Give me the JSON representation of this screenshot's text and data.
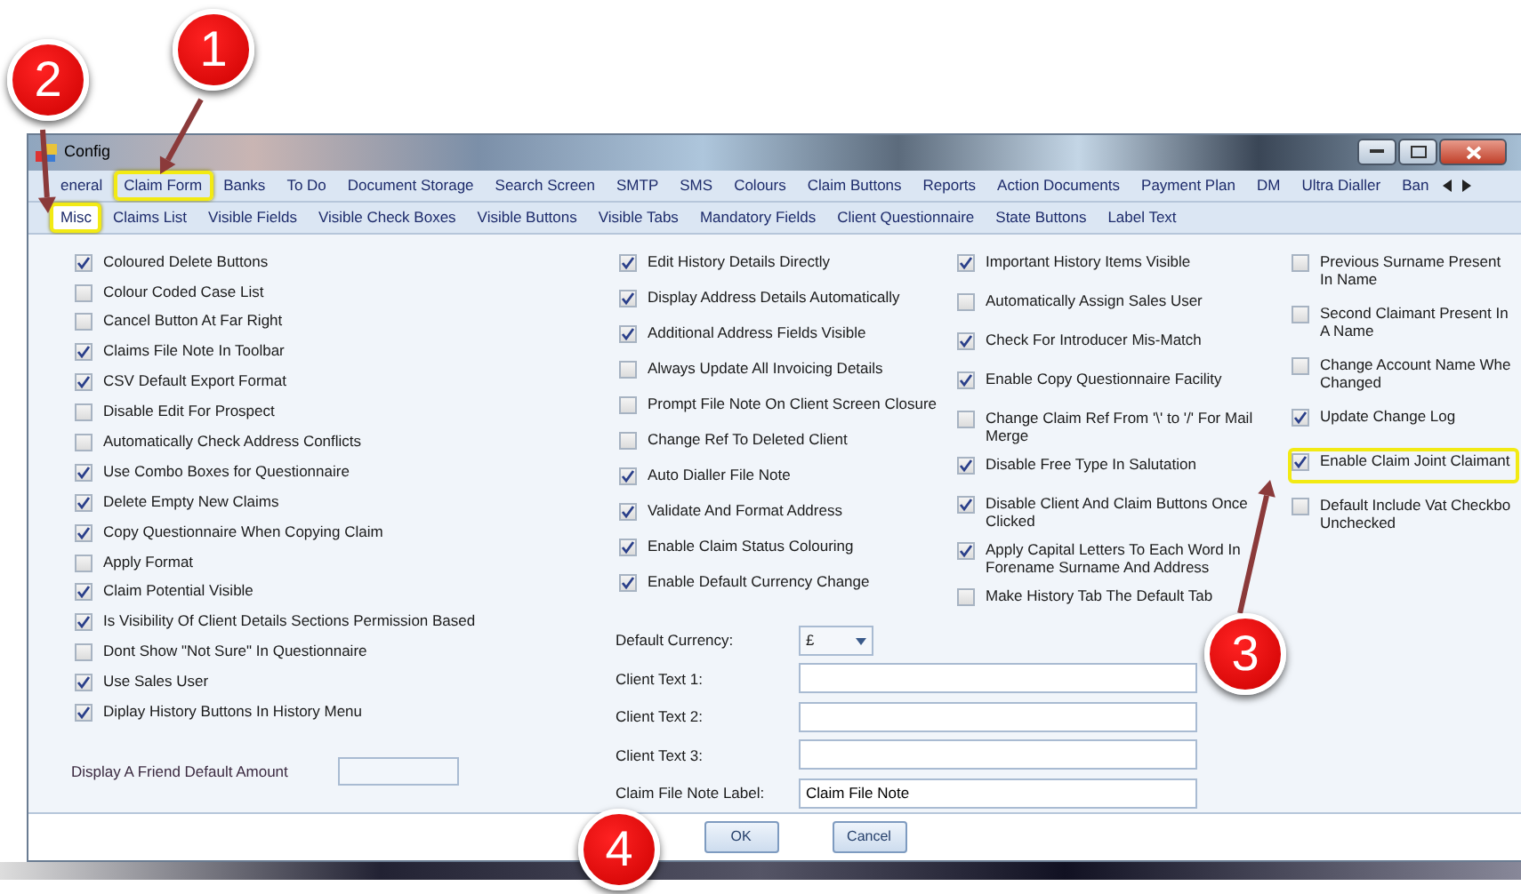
{
  "window": {
    "title": "Config"
  },
  "tabs_row_1": [
    {
      "label": "eneral",
      "selected": false,
      "highlighted": false
    },
    {
      "label": "Claim Form",
      "selected": false,
      "highlighted": true
    },
    {
      "label": "Banks",
      "selected": false,
      "highlighted": false
    },
    {
      "label": "To Do",
      "selected": false,
      "highlighted": false
    },
    {
      "label": "Document Storage",
      "selected": false,
      "highlighted": false
    },
    {
      "label": "Search Screen",
      "selected": false,
      "highlighted": false
    },
    {
      "label": "SMTP",
      "selected": false,
      "highlighted": false
    },
    {
      "label": "SMS",
      "selected": false,
      "highlighted": false
    },
    {
      "label": "Colours",
      "selected": false,
      "highlighted": false
    },
    {
      "label": "Claim Buttons",
      "selected": false,
      "highlighted": false
    },
    {
      "label": "Reports",
      "selected": false,
      "highlighted": false
    },
    {
      "label": "Action Documents",
      "selected": false,
      "highlighted": false
    },
    {
      "label": "Payment Plan",
      "selected": false,
      "highlighted": false
    },
    {
      "label": "DM",
      "selected": false,
      "highlighted": false
    },
    {
      "label": "Ultra Dialler",
      "selected": false,
      "highlighted": false
    },
    {
      "label": "Ban",
      "selected": false,
      "highlighted": false
    }
  ],
  "tabs_row_2": [
    {
      "label": "Misc",
      "selected": true,
      "highlighted": true
    },
    {
      "label": "Claims List",
      "selected": false,
      "highlighted": false
    },
    {
      "label": "Visible Fields",
      "selected": false,
      "highlighted": false
    },
    {
      "label": "Visible Check Boxes",
      "selected": false,
      "highlighted": false
    },
    {
      "label": "Visible Buttons",
      "selected": false,
      "highlighted": false
    },
    {
      "label": "Visible Tabs",
      "selected": false,
      "highlighted": false
    },
    {
      "label": "Mandatory Fields",
      "selected": false,
      "highlighted": false
    },
    {
      "label": "Client Questionnaire",
      "selected": false,
      "highlighted": false
    },
    {
      "label": "State Buttons",
      "selected": false,
      "highlighted": false
    },
    {
      "label": "Label Text",
      "selected": false,
      "highlighted": false
    }
  ],
  "column_1": [
    {
      "label": "Coloured Delete Buttons",
      "checked": true
    },
    {
      "label": "Colour Coded Case List",
      "checked": false
    },
    {
      "label": "Cancel Button At Far Right",
      "checked": false
    },
    {
      "label": "Claims File Note In Toolbar",
      "checked": true
    },
    {
      "label": "CSV Default Export Format",
      "checked": true
    },
    {
      "label": "Disable Edit For Prospect",
      "checked": false
    },
    {
      "label": "Automatically Check Address Conflicts",
      "checked": false
    },
    {
      "label": "Use Combo Boxes for Questionnaire",
      "checked": true
    },
    {
      "label": "Delete Empty New Claims",
      "checked": true
    },
    {
      "label": "Copy Questionnaire When Copying Claim",
      "checked": true
    },
    {
      "label": "Apply Format",
      "checked": false
    },
    {
      "label": "Claim Potential Visible",
      "checked": true
    },
    {
      "label": "Is Visibility Of Client Details Sections Permission Based",
      "checked": true
    },
    {
      "label": "Dont Show \"Not Sure\" In Questionnaire",
      "checked": false
    },
    {
      "label": "Use Sales User",
      "checked": true
    },
    {
      "label": "Diplay History Buttons In History Menu",
      "checked": true
    }
  ],
  "friend_amount": {
    "label": "Display A Friend Default Amount"
  },
  "column_2": [
    {
      "label": "Edit History Details Directly",
      "checked": true
    },
    {
      "label": "Display Address Details Automatically",
      "checked": true
    },
    {
      "label": "Additional Address Fields Visible",
      "checked": true
    },
    {
      "label": "Always Update All Invoicing Details",
      "checked": false
    },
    {
      "label": "Prompt File Note On Client Screen Closure",
      "checked": false
    },
    {
      "label": "Change Ref To Deleted Client",
      "checked": false
    },
    {
      "label": "Auto Dialler File Note",
      "checked": true
    },
    {
      "label": "Validate And Format Address",
      "checked": true
    },
    {
      "label": "Enable Claim Status Colouring",
      "checked": true
    },
    {
      "label": "Enable Default Currency Change",
      "checked": true
    }
  ],
  "default_currency": {
    "label": "Default Currency:",
    "value": "£"
  },
  "text_fields": [
    {
      "label": "Client Text 1:"
    },
    {
      "label": "Client Text 2:"
    },
    {
      "label": "Client Text 3:"
    },
    {
      "label": "Claim File Note Label:",
      "value": "Claim File Note"
    }
  ],
  "column_3": [
    {
      "label": "Important History Items Visible",
      "checked": true
    },
    {
      "label": "Automatically Assign Sales User",
      "checked": false
    },
    {
      "label": "Check For Introducer Mis-Match",
      "checked": true
    },
    {
      "label": "Enable Copy Questionnaire Facility",
      "checked": true
    },
    {
      "label": "Change Claim Ref  From '\\' to '/' For Mail Merge",
      "checked": false
    },
    {
      "label": "Disable Free Type In Salutation",
      "checked": true
    },
    {
      "label": "Disable Client And Claim Buttons Once Clicked",
      "checked": true
    },
    {
      "label": "Apply Capital Letters To Each Word In Forename Surname And Address",
      "checked": true
    },
    {
      "label": "Make History Tab The Default Tab",
      "checked": false
    }
  ],
  "column_4": [
    {
      "label": "Previous Surname Present In Name",
      "checked": false,
      "highlighted": false
    },
    {
      "label": "Second Claimant Present In A Name",
      "checked": false,
      "highlighted": false
    },
    {
      "label": "Change Account Name Whe Changed",
      "checked": false,
      "highlighted": false
    },
    {
      "label": "Update Change Log",
      "checked": true,
      "highlighted": false
    },
    {
      "label": "Enable Claim Joint Claimant",
      "checked": true,
      "highlighted": true
    },
    {
      "label": "Default Include Vat Checkbo Unchecked",
      "checked": false,
      "highlighted": false
    }
  ],
  "buttons": [
    "OK",
    "Cancel"
  ],
  "callouts": [
    {
      "number": "1"
    },
    {
      "number": "2"
    },
    {
      "number": "3"
    },
    {
      "number": "4"
    }
  ]
}
